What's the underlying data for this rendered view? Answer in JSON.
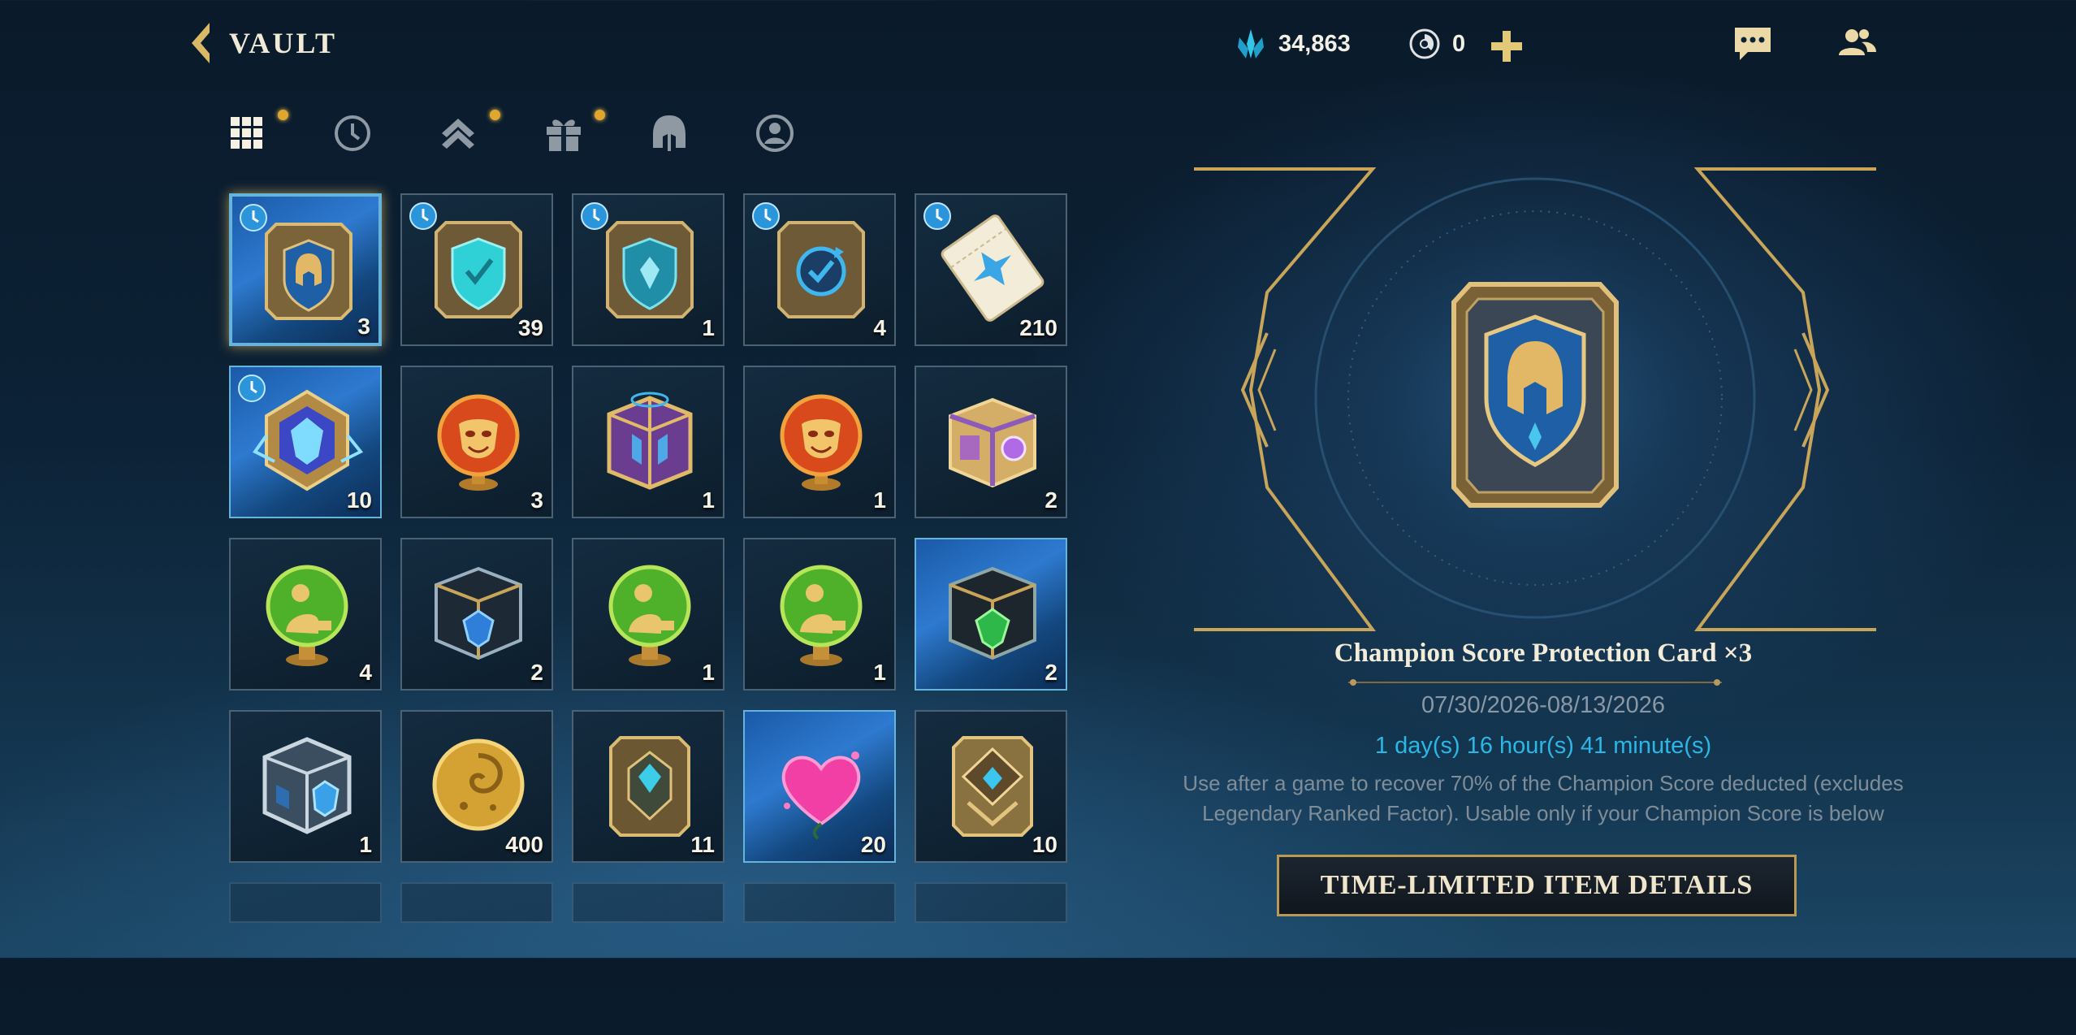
{
  "header": {
    "back_label": "VAULT"
  },
  "currencies": [
    {
      "icon": "blue-crystal-icon",
      "value": "34,863"
    },
    {
      "icon": "wild-core-icon",
      "value": "0"
    }
  ],
  "tabs": [
    {
      "name": "grid-view-icon",
      "notification": true
    },
    {
      "name": "history-clock-icon",
      "notification": false
    },
    {
      "name": "rank-chevron-icon",
      "notification": true
    },
    {
      "name": "gift-icon",
      "notification": true
    },
    {
      "name": "helmet-icon",
      "notification": false
    },
    {
      "name": "profile-icon",
      "notification": false
    }
  ],
  "items": [
    {
      "art": "champion-card",
      "count": "3",
      "timed": true,
      "style": "selected-blue"
    },
    {
      "art": "teal-shield-card",
      "count": "39",
      "timed": true,
      "style": ""
    },
    {
      "art": "shield-card",
      "count": "1",
      "timed": true,
      "style": ""
    },
    {
      "art": "refresh-card",
      "count": "4",
      "timed": true,
      "style": ""
    },
    {
      "art": "ticket",
      "count": "210",
      "timed": true,
      "style": ""
    },
    {
      "art": "blue-gem-emblem",
      "count": "10",
      "timed": true,
      "style": "blue"
    },
    {
      "art": "red-emote-orb",
      "count": "3",
      "timed": false,
      "style": ""
    },
    {
      "art": "purple-chest",
      "count": "1",
      "timed": false,
      "style": ""
    },
    {
      "art": "red-emote-orb",
      "count": "1",
      "timed": false,
      "style": ""
    },
    {
      "art": "purple-gold-chest",
      "count": "2",
      "timed": false,
      "style": ""
    },
    {
      "art": "green-orb",
      "count": "4",
      "timed": false,
      "style": ""
    },
    {
      "art": "dark-blue-chest",
      "count": "2",
      "timed": false,
      "style": ""
    },
    {
      "art": "green-orb",
      "count": "1",
      "timed": false,
      "style": ""
    },
    {
      "art": "green-orb",
      "count": "1",
      "timed": false,
      "style": ""
    },
    {
      "art": "green-chest",
      "count": "2",
      "timed": false,
      "style": "blue"
    },
    {
      "art": "silver-cube",
      "count": "1",
      "timed": false,
      "style": ""
    },
    {
      "art": "gold-coin",
      "count": "400",
      "timed": false,
      "style": ""
    },
    {
      "art": "gem-card",
      "count": "11",
      "timed": false,
      "style": ""
    },
    {
      "art": "pink-heart",
      "count": "20",
      "timed": false,
      "style": "blue"
    },
    {
      "art": "rank-card",
      "count": "10",
      "timed": false,
      "style": ""
    }
  ],
  "detail": {
    "title": "Champion Score Protection Card ×3",
    "dates": "07/30/2026-08/13/2026",
    "timer": "1 day(s) 16 hour(s) 41 minute(s)",
    "description": "Use after a game to recover 70% of the Champion Score deducted (excludes Legendary Ranked Factor). Usable only if your Champion Score is below",
    "action_label": "TIME-LIMITED ITEM DETAILS"
  },
  "colors": {
    "gold": "#d8b55c",
    "accent_blue": "#2bb7e6",
    "notification": "#e0a62d"
  }
}
